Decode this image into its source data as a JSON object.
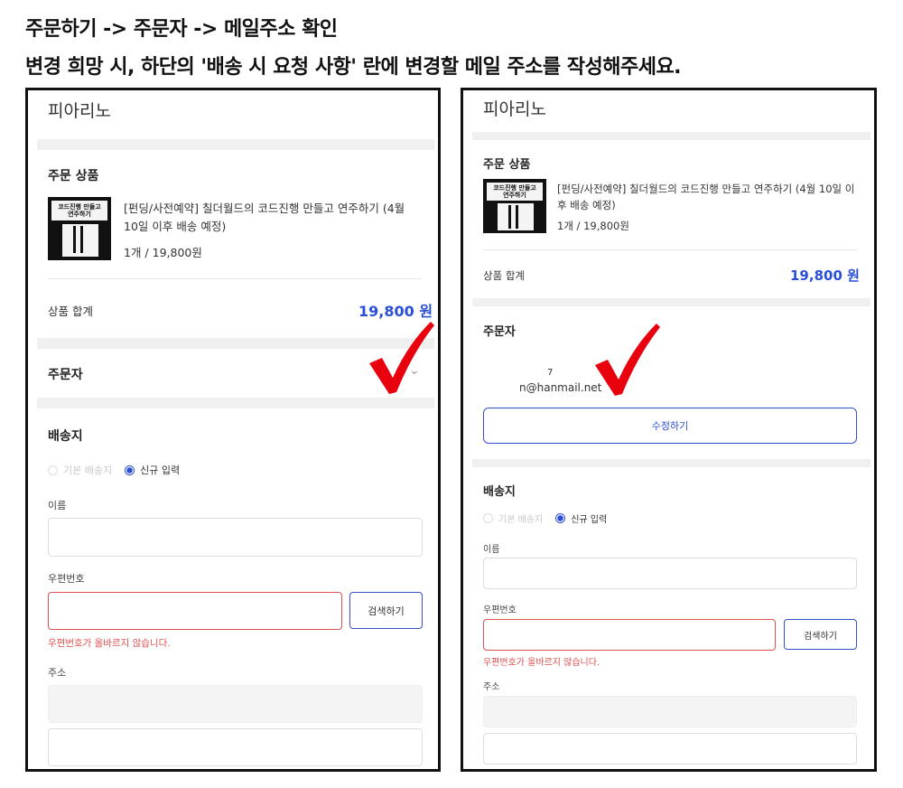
{
  "instructions": {
    "line1": "주문하기 -> 주문자 -> 메일주소 확인",
    "line2": "변경 희망 시, 하단의 '배송 시 요청 사항' 란에 변경할 메일 주소를 작성해주세요."
  },
  "shop_name": "피아리노",
  "order_items": {
    "title": "주문 상품",
    "product_name": "[펀딩/사전예약] 칠더월드의 코드진행 만들고 연주하기 (4월 10일 이후 배송 예정)",
    "quantity_price": "1개 / 19,800원",
    "cover_text_top": "코드진행 만들고",
    "cover_text_bottom": "연주하기"
  },
  "summary": {
    "label": "상품 합계",
    "value_left": "19,800 원",
    "value_right": "19,800 원"
  },
  "orderer": {
    "title": "주문자",
    "email_prefix": "7",
    "email": "n@hanmail.net",
    "edit_button": "수정하기"
  },
  "shipping": {
    "title": "배송지",
    "option_default": "기본 배송지",
    "option_new": "신규 입력",
    "name_label": "이름",
    "postcode_label": "우편번호",
    "search_button": "검색하기",
    "postcode_error": "우편번호가 올바르지 않습니다.",
    "address_label": "주소"
  },
  "colors": {
    "accent": "#2a4fd6",
    "error": "#e05050",
    "checkmark": "#e8000e"
  },
  "icons": {
    "expand": "chevron-down-icon",
    "annotation": "red-checkmark"
  }
}
